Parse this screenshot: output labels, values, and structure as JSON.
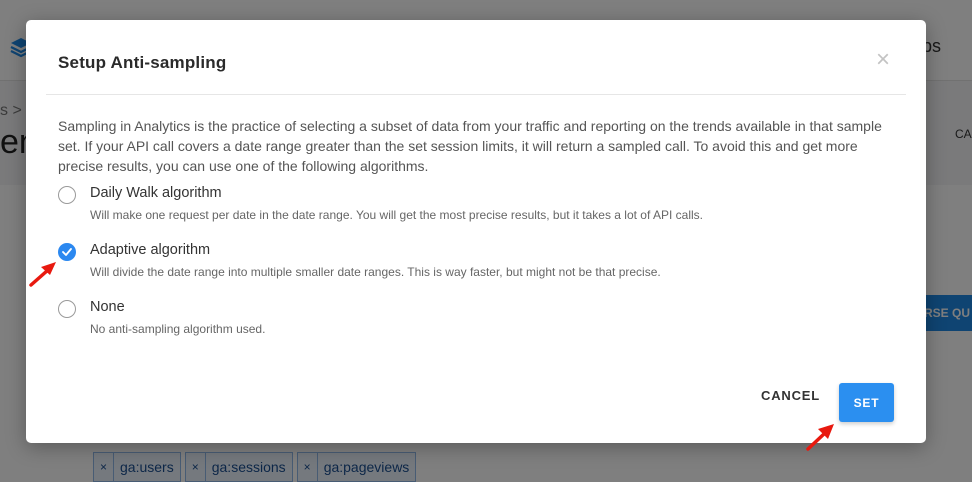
{
  "background": {
    "tab_fragment": "bs",
    "breadcrumb_fragment": "s > C",
    "heading_fragment": "en",
    "right_label_fragment": "CA",
    "blue_button_fragment": "RSE QU",
    "chips": [
      {
        "remove": "×",
        "label": "ga:users"
      },
      {
        "remove": "×",
        "label": "ga:sessions"
      },
      {
        "remove": "×",
        "label": "ga:pageviews"
      }
    ]
  },
  "modal": {
    "title": "Setup Anti-sampling",
    "close_glyph": "×",
    "description": "Sampling in Analytics is the practice of selecting a subset of data from your traffic and reporting on the trends available in that sample set. If your API call covers a date range greater than the set session limits, it will return a sampled call. To avoid this and get more precise results, you can use one of the following algorithms.",
    "options": [
      {
        "label": "Daily Walk algorithm",
        "description": "Will make one request per date in the date range. You will get the most precise results, but it takes a lot of API calls.",
        "checked": false
      },
      {
        "label": "Adaptive algorithm",
        "description": "Will divide the date range into multiple smaller date ranges. This is way faster, but might not be that precise.",
        "checked": true
      },
      {
        "label": "None",
        "description": "No anti-sampling algorithm used.",
        "checked": false
      }
    ],
    "cancel_label": "CANCEL",
    "set_label": "SET"
  },
  "colors": {
    "accent": "#2b8ff0",
    "annotation_arrow": "#e8190f"
  }
}
